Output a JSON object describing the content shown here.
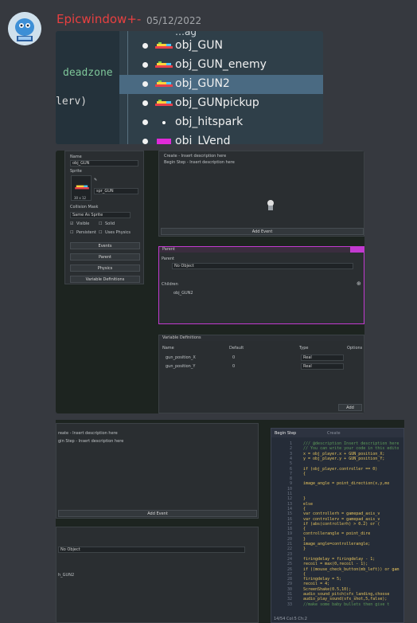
{
  "message": {
    "author": "Epicwindow+-",
    "date": "05/12/2022"
  },
  "attachment1": {
    "code_words": [
      "deadzone",
      "lerv)"
    ],
    "items": [
      {
        "label": "obj_GUN",
        "selected": false,
        "icon": "gun-sprite-icon"
      },
      {
        "label": "obj_GUN_enemy",
        "selected": false,
        "icon": "gun-sprite-icon"
      },
      {
        "label": "obj_GUN2",
        "selected": true,
        "icon": "gun-sprite-icon"
      },
      {
        "label": "obj_GUNpickup",
        "selected": false,
        "icon": "gun-sprite-icon"
      },
      {
        "label": "obj_hitspark",
        "selected": false,
        "icon": "spark-sprite-icon"
      },
      {
        "label": "obj_LVend",
        "selected": false,
        "icon": "vend-sprite-icon"
      }
    ]
  },
  "attachment2": {
    "object_panel": {
      "name_label": "Name",
      "name_value": "obj_GUN",
      "sprite_label": "Sprite",
      "sprite_value": "spr_GUN",
      "sprite_size": "30 x 12",
      "collision_label": "Collision Mask",
      "collision_value": "Same As Sprite",
      "visible_label": "Visible",
      "solid_label": "Solid",
      "persistent_label": "Persistent",
      "physics_label": "Uses Physics",
      "buttons": [
        "Events",
        "Parent",
        "Physics",
        "Variable Definitions"
      ]
    },
    "events_panel": {
      "items": [
        "Create - Insert description here",
        "Begin Step - Insert description here"
      ],
      "add_label": "Add Event"
    },
    "parent_panel": {
      "title": "Parent",
      "parent_label": "Parent",
      "parent_value": "No Object",
      "children_label": "Children",
      "child": "obj_GUN2"
    },
    "variables_panel": {
      "title": "Variable Definitions",
      "columns": [
        "Name",
        "Default",
        "Type",
        "Options"
      ],
      "rows": [
        {
          "name": "gun_position_X",
          "default": "0",
          "type": "Real"
        },
        {
          "name": "gun_position_Y",
          "default": "0",
          "type": "Real"
        }
      ],
      "add_label": "Add"
    }
  },
  "attachment3": {
    "events": [
      "reate - Insert description here",
      "gin Step - Insert description here"
    ],
    "add_label": "Add Event",
    "parent_value": "No Object",
    "child": "h_GUN2",
    "tabs": [
      "Begin Step",
      "Create"
    ],
    "status": "14/54 Col:5 Ch:2",
    "code_lines": [
      {
        "n": "1",
        "t": "/// @description Insert description here",
        "c": "#5d9c59"
      },
      {
        "n": "2",
        "t": "// You can write your code in this edito",
        "c": "#5d9c59"
      },
      {
        "n": "3",
        "t": "x = obj_player.x + GUN_position_X;",
        "c": "#e6c35c"
      },
      {
        "n": "4",
        "t": "y = obj_player.y + GUN_position_Y;",
        "c": "#e6c35c"
      },
      {
        "n": "5",
        "t": "",
        "c": "#e6c35c"
      },
      {
        "n": "6",
        "t": "if (obj_player.controller == 0)",
        "c": "#e6c35c"
      },
      {
        "n": "7",
        "t": "{",
        "c": "#e6c35c"
      },
      {
        "n": "8",
        "t": "",
        "c": "#e6c35c"
      },
      {
        "n": "9",
        "t": "    image_angle = point_direction(x,y,mo",
        "c": "#e6c35c"
      },
      {
        "n": "10",
        "t": "",
        "c": "#e6c35c"
      },
      {
        "n": "11",
        "t": "",
        "c": "#e6c35c"
      },
      {
        "n": "12",
        "t": "}",
        "c": "#e6c35c"
      },
      {
        "n": "13",
        "t": "else",
        "c": "#e6c35c"
      },
      {
        "n": "14",
        "t": "{",
        "c": "#e6c35c"
      },
      {
        "n": "15",
        "t": "    var controllerh = gamepad_axis_v",
        "c": "#e6c35c"
      },
      {
        "n": "16",
        "t": "    var controllerv = gamepad_axis_v",
        "c": "#e6c35c"
      },
      {
        "n": "17",
        "t": "    if (abs(controllerh) > 0.2) or (",
        "c": "#e6c35c"
      },
      {
        "n": "18",
        "t": "    {",
        "c": "#e6c35c"
      },
      {
        "n": "19",
        "t": "        controllerangle = point_dire",
        "c": "#e6c35c"
      },
      {
        "n": "20",
        "t": "    }",
        "c": "#e6c35c"
      },
      {
        "n": "21",
        "t": "    image_angle=controllerangle;",
        "c": "#e6c35c"
      },
      {
        "n": "22",
        "t": "}",
        "c": "#e6c35c"
      },
      {
        "n": "23",
        "t": "",
        "c": "#e6c35c"
      },
      {
        "n": "24",
        "t": "firingdelay = firingdelay - 1;",
        "c": "#e6c35c"
      },
      {
        "n": "25",
        "t": "recoil = max(0,recoil - 1);",
        "c": "#e6c35c"
      },
      {
        "n": "26",
        "t": "if ((mouse_check_button(mb_left)) or gam",
        "c": "#e6c35c"
      },
      {
        "n": "27",
        "t": "{",
        "c": "#e6c35c"
      },
      {
        "n": "28",
        "t": "    firingdelay = 5;",
        "c": "#e6c35c"
      },
      {
        "n": "29",
        "t": "    recoil = 4;",
        "c": "#e6c35c"
      },
      {
        "n": "30",
        "t": "    ScreenShake(0.5,10);",
        "c": "#e6c35c"
      },
      {
        "n": "31",
        "t": "    audio_sound_pitch(sfx_landing,choose",
        "c": "#e6c35c"
      },
      {
        "n": "32",
        "t": "    audio_play_sound(sfx_shot,5,false);",
        "c": "#e6c35c"
      },
      {
        "n": "33",
        "t": "    //make some baby bullets then give t",
        "c": "#5d9c59"
      }
    ]
  },
  "colors": {
    "author": "#e84040",
    "selection": "#4a6a82",
    "parent_accent": "#c23ad0"
  }
}
